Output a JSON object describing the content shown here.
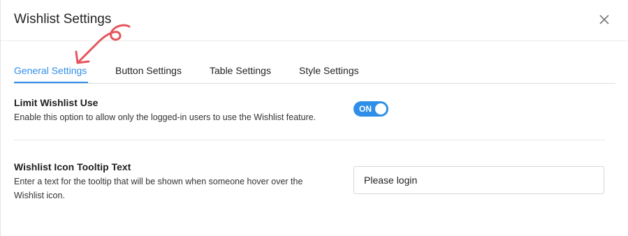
{
  "modal": {
    "title": "Wishlist Settings",
    "close_icon": "close-icon"
  },
  "tabs": [
    {
      "label": "General Settings",
      "active": true
    },
    {
      "label": "Button Settings",
      "active": false
    },
    {
      "label": "Table Settings",
      "active": false
    },
    {
      "label": "Style Settings",
      "active": false
    }
  ],
  "settings": {
    "limit_use": {
      "title": "Limit Wishlist Use",
      "description": "Enable this option to allow only the logged-in users to use the Wishlist feature.",
      "toggle_label": "ON",
      "enabled": true
    },
    "tooltip_text": {
      "title": "Wishlist Icon Tooltip Text",
      "description_line1": "Enter a text for the tooltip that will be shown when someone hover over the",
      "description_line2": "Wishlist icon.",
      "value": "Please login"
    }
  },
  "colors": {
    "accent": "#2f8fe8",
    "annotation": "#e4565c"
  }
}
